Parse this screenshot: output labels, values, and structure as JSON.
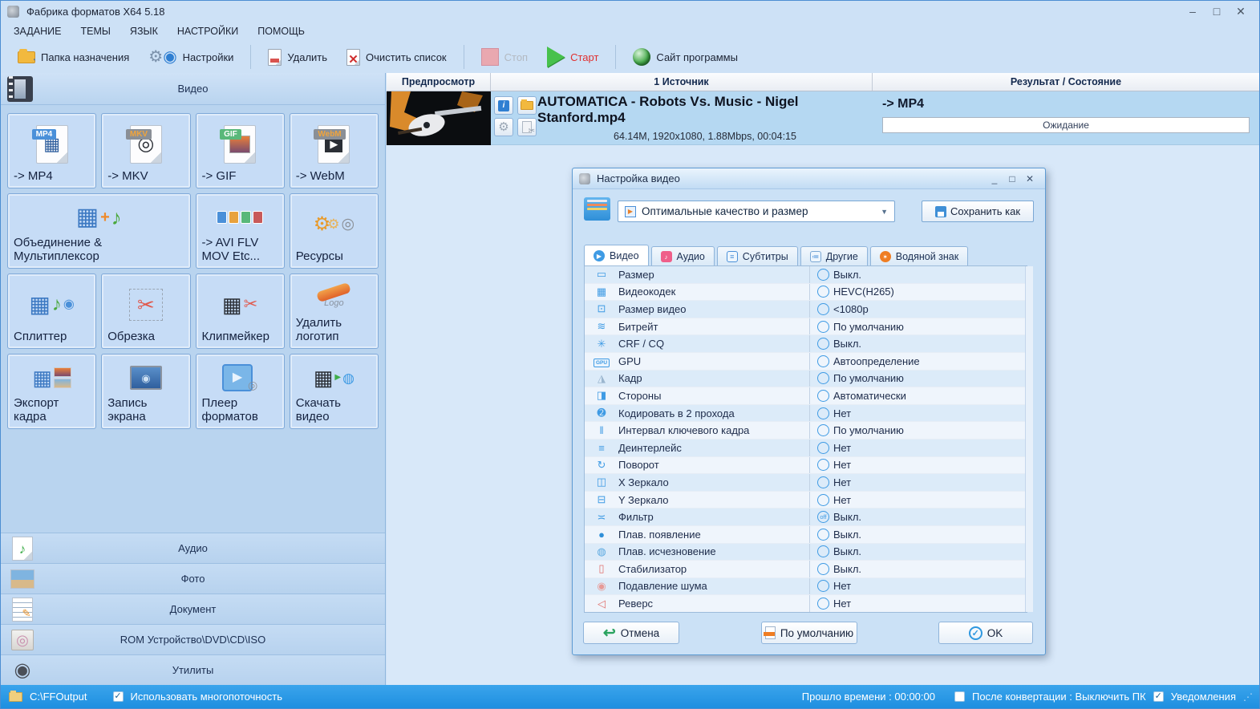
{
  "window": {
    "title": "Фабрика форматов X64 5.18",
    "controls": {
      "minimize": "–",
      "maximize": "□",
      "close": "✕"
    }
  },
  "menu": {
    "items": [
      "ЗАДАНИЕ",
      "ТЕМЫ",
      "ЯЗЫК",
      "НАСТРОЙКИ",
      "ПОМОЩЬ"
    ]
  },
  "toolbar": {
    "dest_folder": "Папка назначения",
    "settings": "Настройки",
    "delete": "Удалить",
    "clear_list": "Очистить список",
    "stop": "Стоп",
    "start": "Старт",
    "site": "Сайт программы"
  },
  "sidebar": {
    "video_header": "Видео",
    "tiles": [
      {
        "name": "tile-to-mp4",
        "icon": "mp4-file-icon",
        "badge": "MP4",
        "label": "-> MP4"
      },
      {
        "name": "tile-to-mkv",
        "icon": "mkv-file-icon",
        "badge": "MKV",
        "label": "-> MKV"
      },
      {
        "name": "tile-to-gif",
        "icon": "gif-file-icon",
        "badge": "GIF",
        "label": "-> GIF"
      },
      {
        "name": "tile-to-webm",
        "icon": "webm-file-icon",
        "badge": "WebM",
        "label": "-> WebM"
      },
      {
        "name": "tile-mux",
        "icon": "mux-icon",
        "label": "Объединение & Мультиплексор"
      },
      {
        "name": "tile-to-avi-flv",
        "icon": "avi-flv-icon",
        "label": "-> AVI FLV MOV Etc..."
      },
      {
        "name": "tile-resources",
        "icon": "resources-icon",
        "label": "Ресурсы"
      },
      {
        "name": "tile-splitter",
        "icon": "splitter-icon",
        "label": "Сплиттер"
      },
      {
        "name": "tile-crop",
        "icon": "crop-icon",
        "label": "Обрезка"
      },
      {
        "name": "tile-clipmaker",
        "icon": "clipmaker-icon",
        "label": "Клипмейкер"
      },
      {
        "name": "tile-remove-logo",
        "icon": "remove-logo-icon",
        "logo_text": "Logo",
        "label": "Удалить логотип"
      },
      {
        "name": "tile-export-frame",
        "icon": "export-frame-icon",
        "label": "Экспорт кадра"
      },
      {
        "name": "tile-screen-record",
        "icon": "screen-record-icon",
        "label": "Запись экрана"
      },
      {
        "name": "tile-format-player",
        "icon": "player-icon",
        "label": "Плеер форматов"
      },
      {
        "name": "tile-download-video",
        "icon": "download-video-icon",
        "label": "Скачать видео"
      }
    ],
    "categories": [
      {
        "name": "category-audio",
        "icon": "audio-note-icon",
        "label": "Аудио"
      },
      {
        "name": "category-photo",
        "icon": "photo-icon",
        "label": "Фото"
      },
      {
        "name": "category-document",
        "icon": "document-icon",
        "label": "Документ"
      },
      {
        "name": "category-rom",
        "icon": "disc-icon",
        "label": "ROM Устройство\\DVD\\CD\\ISO"
      },
      {
        "name": "category-utilities",
        "icon": "reel-icon",
        "label": "Утилиты"
      }
    ]
  },
  "filelist": {
    "headers": {
      "preview": "Предпросмотр",
      "source": "1 Источник",
      "result": "Результат / Состояние"
    },
    "row": {
      "filename": "AUTOMATICA - Robots Vs. Music - Nigel Stanford.mp4",
      "details": "64.14M, 1920x1080, 1.88Mbps, 00:04:15",
      "target": "-> MP4",
      "status": "Ожидание"
    }
  },
  "dialog": {
    "title": "Настройка видео",
    "preset": "Оптимальные качество и размер",
    "save_as": "Сохранить как",
    "controls": {
      "minimize": "_",
      "maximize": "□",
      "close": "✕"
    },
    "tabs": [
      {
        "label": "Видео"
      },
      {
        "label": "Аудио"
      },
      {
        "label": "Субтитры"
      },
      {
        "label": "Другие"
      },
      {
        "label": "Водяной знак"
      }
    ],
    "rows": [
      {
        "icon": "ruler-icon",
        "label": "Размер",
        "value": "Выкл."
      },
      {
        "icon": "codec-icon",
        "label": "Видеокодек",
        "value": "HEVC(H265)"
      },
      {
        "icon": "video-size-icon",
        "label": "Размер видео",
        "value": "<1080p"
      },
      {
        "icon": "bitrate-icon",
        "label": "Битрейт",
        "value": "По умолчанию"
      },
      {
        "icon": "crf-icon",
        "label": "CRF / CQ",
        "value": "Выкл."
      },
      {
        "icon": "gpu-icon",
        "label": "GPU",
        "value": "Автоопределение"
      },
      {
        "icon": "frame-rate-icon",
        "label": "Кадр",
        "value": "По умолчанию"
      },
      {
        "icon": "aspect-icon",
        "label": "Стороны",
        "value": "Автоматически"
      },
      {
        "icon": "two-pass-icon",
        "label": "Кодировать в 2 прохода",
        "value": "Нет"
      },
      {
        "icon": "keyframe-interval-icon",
        "label": "Интервал ключевого кадра",
        "value": "По умолчанию"
      },
      {
        "icon": "deinterlace-icon",
        "label": "Деинтерлейс",
        "value": "Нет"
      },
      {
        "icon": "rotate-icon",
        "label": "Поворот",
        "value": "Нет"
      },
      {
        "icon": "x-mirror-icon",
        "label": "X Зеркало",
        "value": "Нет"
      },
      {
        "icon": "y-mirror-icon",
        "label": "Y Зеркало",
        "value": "Нет"
      },
      {
        "icon": "filter-icon",
        "label": "Фильтр",
        "value": "Выкл.",
        "value_badge": "off"
      },
      {
        "icon": "fade-in-icon",
        "label": "Плав. появление",
        "value": "Выкл."
      },
      {
        "icon": "fade-out-icon",
        "label": "Плав. исчезновение",
        "value": "Выкл."
      },
      {
        "icon": "stabilizer-icon",
        "label": "Стабилизатор",
        "value": "Выкл."
      },
      {
        "icon": "denoise-icon",
        "label": "Подавление шума",
        "value": "Нет"
      },
      {
        "icon": "reverse-icon",
        "label": "Реверс",
        "value": "Нет"
      }
    ],
    "buttons": {
      "cancel": "Отмена",
      "default": "По умолчанию",
      "ok": "OK"
    }
  },
  "statusbar": {
    "output_path": "C:\\FFOutput",
    "multithread_label": "Использовать многопоточность",
    "elapsed_label": "Прошло времени : 00:00:00",
    "after_conversion_label": "После конвертации : Выключить ПК",
    "notifications_label": "Уведомления"
  },
  "colors": {
    "accent_blue": "#2f8fd8",
    "statusbar_blue": "#2196e8",
    "start_red": "#e03030",
    "panel_blue": "#b9d4ef"
  }
}
